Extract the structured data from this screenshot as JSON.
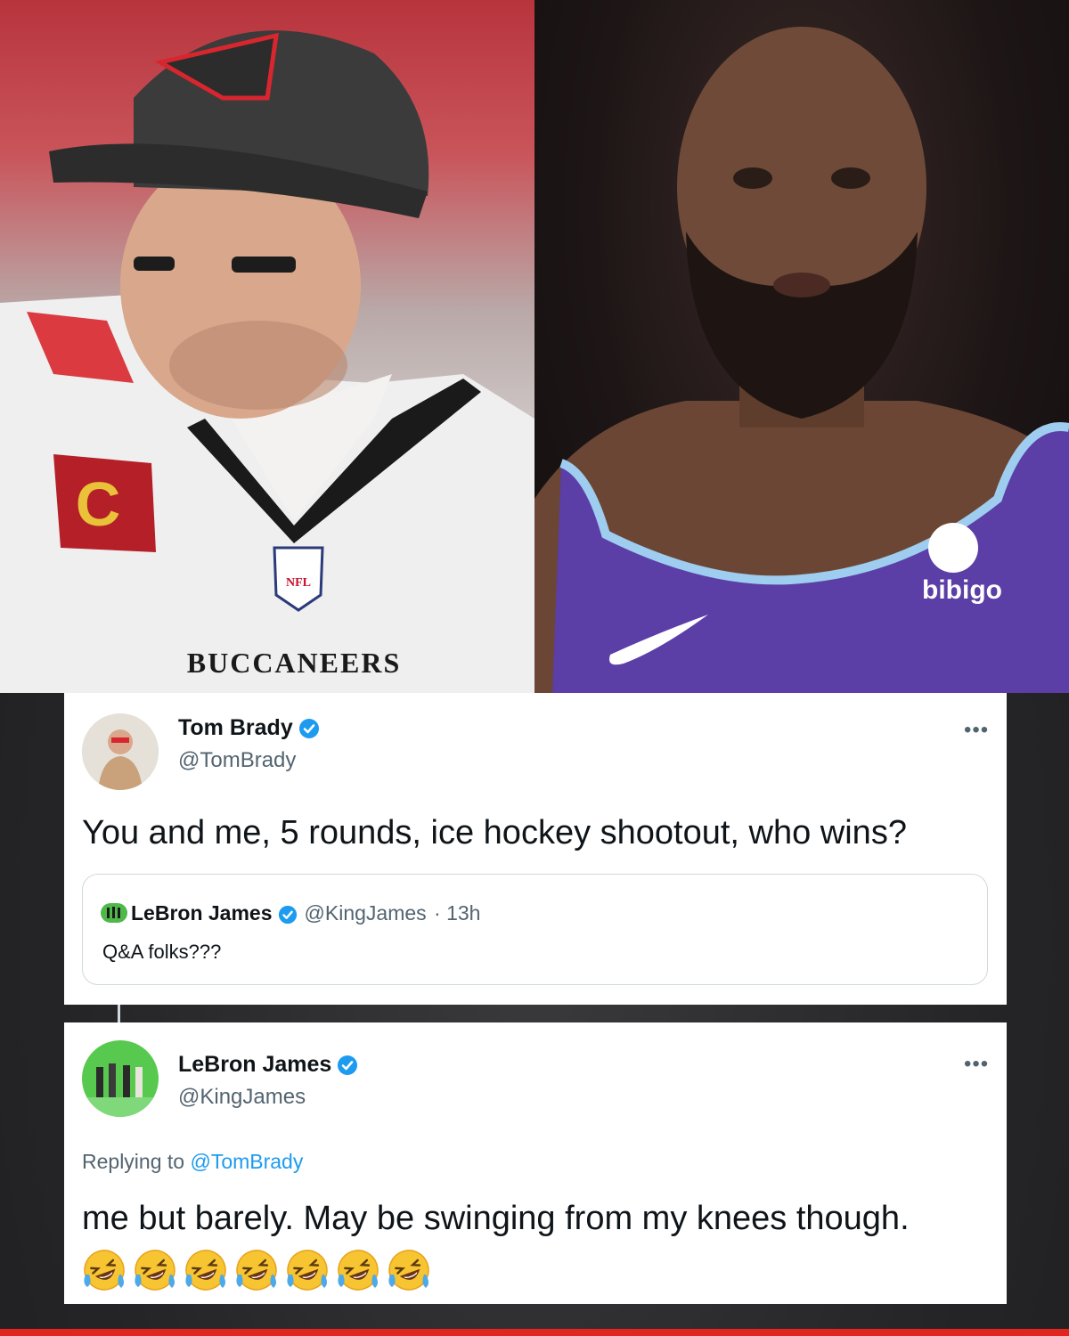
{
  "photos": {
    "left": {
      "jersey_text": "BUCCANEERS",
      "patch_letter": "C",
      "shield_text": "NFL"
    },
    "right": {
      "sponsor_text": "bibigo"
    }
  },
  "tweet_main": {
    "name": "Tom Brady",
    "handle": "@TomBrady",
    "more": "•••",
    "text": "You and me, 5 rounds, ice hockey shootout, who wins?",
    "quote": {
      "name": "LeBron James",
      "handle": "@KingJames",
      "time": "· 13h",
      "text": "Q&A folks???"
    }
  },
  "tweet_reply": {
    "name": "LeBron James",
    "handle": "@KingJames",
    "more": "•••",
    "replying_prefix": "Replying to",
    "replying_mention": "@TomBrady",
    "text": "me but barely. May be swinging from my knees though.",
    "emoji_count": 7
  },
  "colors": {
    "verified": "#1d9bf0",
    "accent_bar": "#e0261d"
  }
}
